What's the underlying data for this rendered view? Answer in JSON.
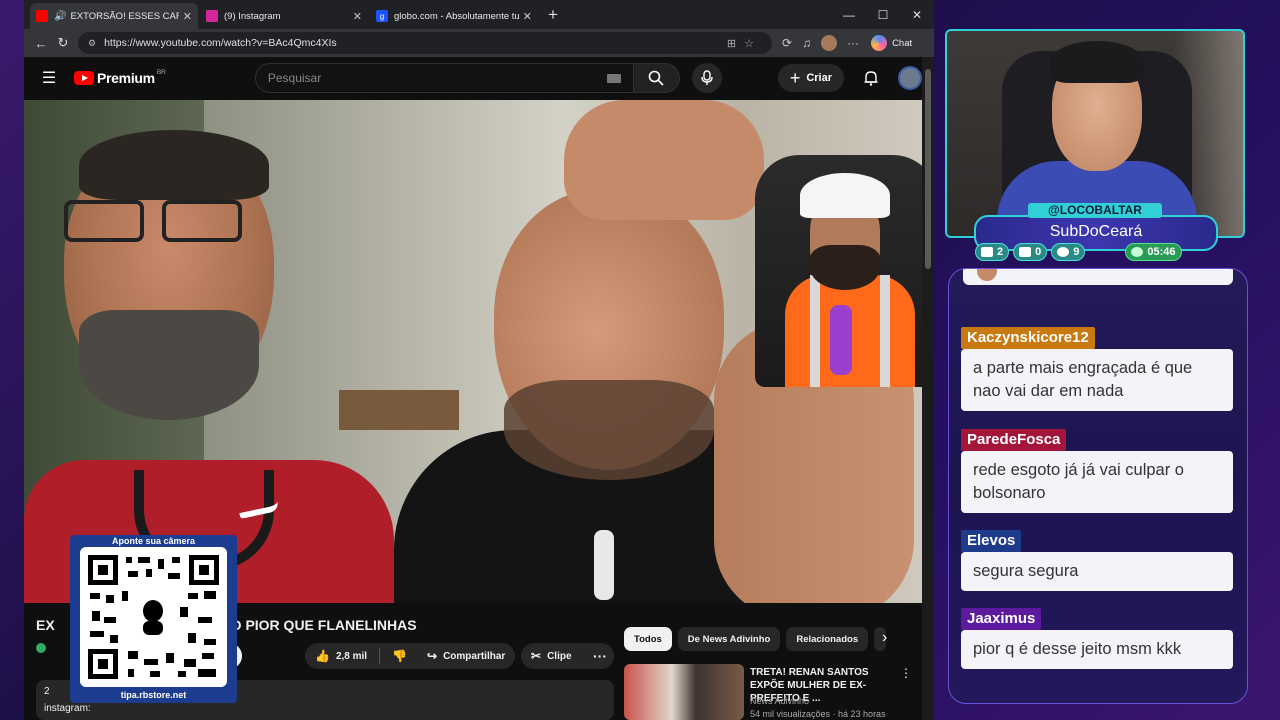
{
  "browser": {
    "tabs": [
      {
        "title": "EXTORSÃO! ESSES CARAS TÃO",
        "active": true,
        "favicon_color": "#ff0000"
      },
      {
        "title": "(9) Instagram",
        "active": false,
        "favicon_color": "#d6249f"
      },
      {
        "title": "globo.com - Absolutamente tudo",
        "active": false,
        "favicon_color": "#1a53ff",
        "favicon_letter": "g"
      }
    ],
    "tab_close": "✕",
    "new_tab": "+",
    "url": "https://www.youtube.com/watch?v=BAc4Qmc4XIs",
    "chat_label": "Chat",
    "window_controls": [
      "—",
      "☐",
      "✕"
    ]
  },
  "youtube": {
    "logo_text": "Premium",
    "country": "BR",
    "search_placeholder": "Pesquisar",
    "create_label": "Criar",
    "video_title_left": "EX",
    "video_title_right": "TÃO PIOR QUE FLANELINHAS",
    "subscribe_label": "r-se",
    "likes": "2,8 mil",
    "share_label": "Compartilhar",
    "clip_label": "Clipe",
    "more_label": "···",
    "desc_line1": "2",
    "desc_line2": "instagram:",
    "chips": [
      {
        "label": "Todos",
        "active": true
      },
      {
        "label": "De News Adivinho",
        "active": false
      },
      {
        "label": "Relacionados",
        "active": false
      }
    ],
    "recommended": {
      "title": "TRETA! RENAN SANTOS EXPÕE MULHER DE EX-PREFEITO E ...",
      "channel": "News Adivinho",
      "meta": "54 mil visualizações · há 23 horas"
    }
  },
  "qr": {
    "top_label": "Aponte sua câmera",
    "bottom_label": "tipa.rbstore.net"
  },
  "stream": {
    "handle": "@LOCOBALTAR",
    "name": "SubDoCeará",
    "stats": [
      {
        "icon": "chat-icon",
        "value": "2"
      },
      {
        "icon": "youtube-icon",
        "value": "0"
      },
      {
        "icon": "at-icon",
        "value": "9"
      }
    ],
    "clock": "05:46",
    "accent": "#31d0d6"
  },
  "chat": {
    "messages": [
      {
        "user": "Kaczynskicore12",
        "text": "a parte mais engraçada é que nao vai dar em nada",
        "color": "#c87a10"
      },
      {
        "user": "ParedeFosca",
        "text": "rede esgoto já já vai culpar o bolsonaro",
        "color": "#a3163a"
      },
      {
        "user": "Elevos",
        "text": "segura segura",
        "color": "#1e3a8a"
      },
      {
        "user": "Jaaximus",
        "text": "pior q é desse jeito msm kkk",
        "color": "#5e1a9e"
      }
    ]
  }
}
